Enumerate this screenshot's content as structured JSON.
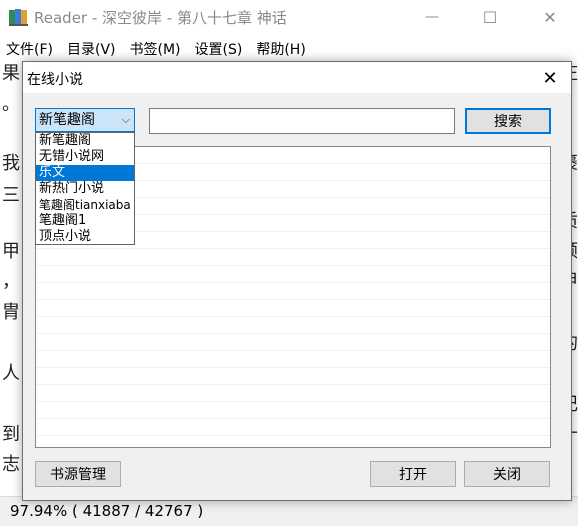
{
  "window": {
    "title": "Reader - 深空彼岸 - 第八十七章 神话",
    "icon": "book-icon",
    "controls": {
      "minimize": "—",
      "maximize": "☐",
      "close": "✕"
    }
  },
  "menu": [
    "文件(F)",
    "目录(V)",
    "书签(M)",
    "设置(S)",
    "帮助(H)"
  ],
  "background_text": {
    "left": [
      "果",
      "。",
      "我",
      "三",
      "甲",
      "，",
      "胄",
      "人",
      "到",
      "志"
    ],
    "right": [
      "庄",
      "褒",
      "质",
      "倾",
      "甲",
      "的",
      "记",
      "十"
    ]
  },
  "status": {
    "progress": "97.94%  ( 41887 / 42767 )"
  },
  "dialog": {
    "title": "在线小说",
    "close_icon": "✕",
    "source_select": {
      "value": "新笔趣阁",
      "chevron": "⌵",
      "options": [
        "新笔趣阁",
        "无错小说网",
        "乐文",
        "新热门小说",
        "笔趣阁tianxiaba",
        "笔趣阁1",
        "顶点小说"
      ],
      "highlighted_index": 2
    },
    "search_input": {
      "value": "",
      "placeholder": ""
    },
    "search_button": "搜索",
    "source_manage_button": "书源管理",
    "open_button": "打开",
    "close_button": "关闭"
  }
}
